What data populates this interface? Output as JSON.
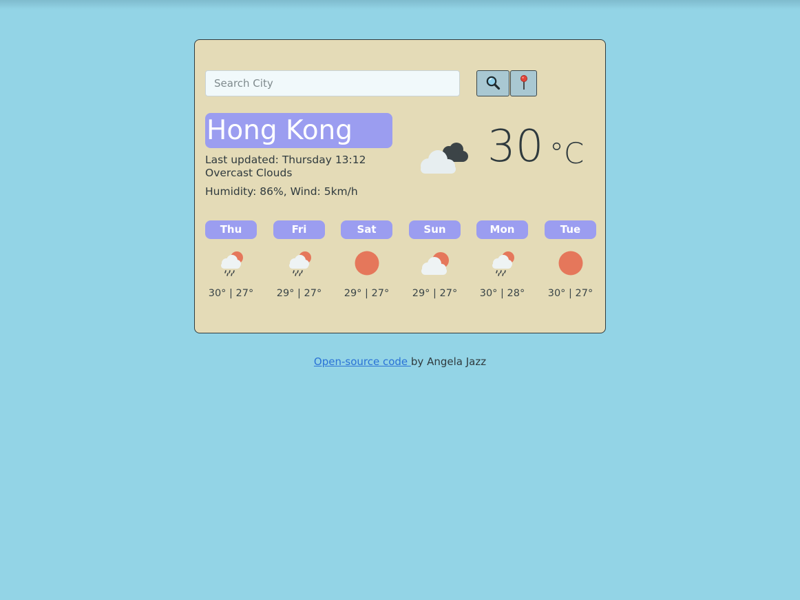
{
  "search": {
    "placeholder": "Search City",
    "value": ""
  },
  "buttons": {
    "search_icon": "magnifier-icon",
    "location_icon": "map-pin-icon"
  },
  "current": {
    "city": "Hong Kong",
    "last_updated": "Last updated: Thursday 13:12",
    "description": "Overcast Clouds",
    "humidity_wind": "Humidity: 86%, Wind: 5km/h",
    "temperature": "30",
    "unit": "°C",
    "icon": "overcast-clouds-icon"
  },
  "forecast": [
    {
      "day": "Thu",
      "icon": "rain-sun-icon",
      "temps": "30° | 27°"
    },
    {
      "day": "Fri",
      "icon": "rain-sun-icon",
      "temps": "29° | 27°"
    },
    {
      "day": "Sat",
      "icon": "sun-icon",
      "temps": "29° | 27°"
    },
    {
      "day": "Sun",
      "icon": "cloud-sun-icon",
      "temps": "29° | 27°"
    },
    {
      "day": "Mon",
      "icon": "rain-sun-icon",
      "temps": "30° | 28°"
    },
    {
      "day": "Tue",
      "icon": "sun-icon",
      "temps": "30° | 27°"
    }
  ],
  "footer": {
    "link_text": "Open-source code ",
    "suffix": "by Angela Jazz"
  },
  "colors": {
    "background": "#93d4e6",
    "card": "#e4dbb7",
    "accent": "#9b9df0",
    "sun": "#e5775b",
    "link": "#2a72d6"
  }
}
